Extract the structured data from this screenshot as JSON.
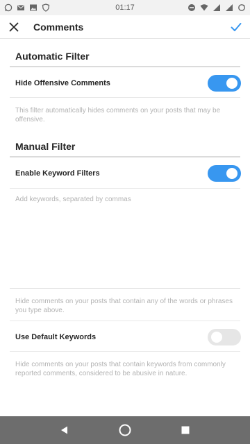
{
  "status_bar": {
    "time": "01:17",
    "left_icons": [
      "whatsapp-icon",
      "gmail-icon",
      "image-icon",
      "shield-icon"
    ],
    "right_icons": [
      "do-not-disturb-icon",
      "wifi-icon",
      "signal-icon",
      "signal-icon",
      "sync-icon"
    ]
  },
  "header": {
    "title": "Comments",
    "close_icon": "close-icon",
    "confirm_icon": "check-icon"
  },
  "automatic_filter": {
    "title": "Automatic Filter",
    "hide_offensive": {
      "label": "Hide Offensive Comments",
      "enabled": true
    },
    "description": "This filter automatically hides comments on your posts that may be offensive."
  },
  "manual_filter": {
    "title": "Manual Filter",
    "enable_keyword": {
      "label": "Enable Keyword Filters",
      "enabled": true
    },
    "keywords_input": {
      "value": "",
      "placeholder": "Add keywords, separated by commas"
    },
    "keywords_description": "Hide comments on your posts that contain any of the words or phrases you type above.",
    "default_keywords": {
      "label": "Use Default Keywords",
      "enabled": false
    },
    "default_description": "Hide comments on your posts that contain keywords from commonly reported comments, considered to be abusive in nature."
  },
  "nav_bar": {
    "buttons": [
      "back-icon",
      "home-icon",
      "recents-icon"
    ]
  },
  "colors": {
    "accent": "#3897f0",
    "toggle_off": "#e6e6e6",
    "nav_bar": "#6d6d6d"
  }
}
